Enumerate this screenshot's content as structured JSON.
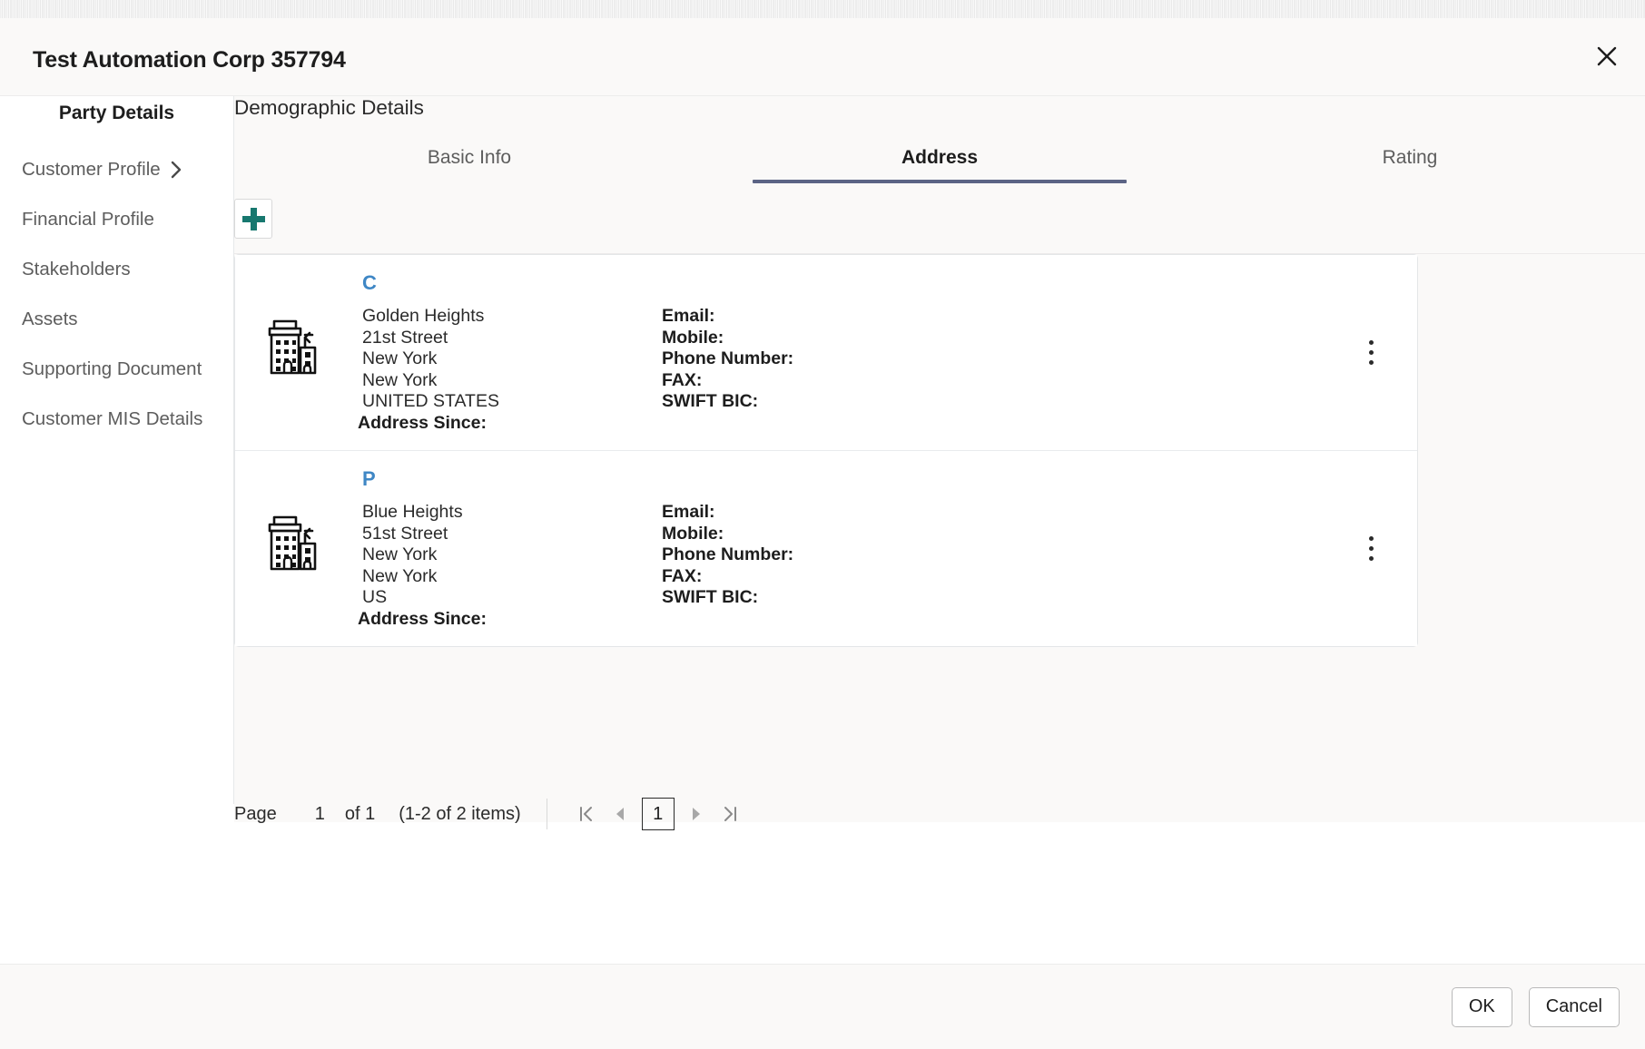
{
  "dialog": {
    "title": "Test Automation Corp 357794",
    "close_icon": "close-icon"
  },
  "sidebar": {
    "heading": "Party Details",
    "items": [
      {
        "label": "Customer Profile",
        "has_chevron": true
      },
      {
        "label": "Financial Profile",
        "has_chevron": false
      },
      {
        "label": "Stakeholders",
        "has_chevron": false
      },
      {
        "label": "Assets",
        "has_chevron": false
      },
      {
        "label": "Supporting Document",
        "has_chevron": false
      },
      {
        "label": "Customer MIS Details",
        "has_chevron": false
      }
    ]
  },
  "main": {
    "section_title": "Demographic Details",
    "tabs": [
      {
        "label": "Basic Info",
        "active": false
      },
      {
        "label": "Address",
        "active": true
      },
      {
        "label": "Rating",
        "active": false
      }
    ],
    "toolbar": {
      "add_icon": "plus-icon"
    },
    "cards": [
      {
        "type_code": "C",
        "icon": "building-icon",
        "address_lines": [
          "Golden Heights",
          "21st Street",
          "New York",
          "New York",
          "UNITED STATES"
        ],
        "address_since_label": "Address Since:",
        "contact": [
          "Email:",
          "Mobile:",
          "Phone Number:",
          "FAX:",
          "SWIFT BIC:"
        ],
        "menu_icon": "kebab-menu-icon"
      },
      {
        "type_code": "P",
        "icon": "building-icon",
        "address_lines": [
          "Blue Heights",
          "51st Street",
          "New York",
          "New York",
          "US"
        ],
        "address_since_label": "Address Since:",
        "contact": [
          "Email:",
          "Mobile:",
          "Phone Number:",
          "FAX:",
          "SWIFT BIC:"
        ],
        "menu_icon": "kebab-menu-icon"
      }
    ],
    "pagination": {
      "page_label": "Page",
      "page_value": "1",
      "of_label": "of 1",
      "items_label": "(1-2 of 2 items)",
      "first_icon": "first-page-icon",
      "prev_icon": "previous-page-icon",
      "current_page": "1",
      "next_icon": "next-page-icon",
      "last_icon": "last-page-icon"
    }
  },
  "footer": {
    "ok_label": "OK",
    "cancel_label": "Cancel"
  },
  "colors": {
    "accent_teal": "#17786f",
    "tab_underline": "#5b6485",
    "addr_type": "#3f87c5",
    "header_bg": "#faf9f8"
  }
}
